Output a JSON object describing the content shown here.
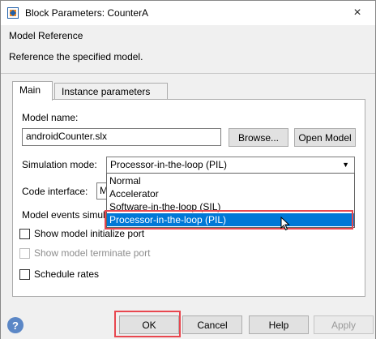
{
  "window": {
    "title": "Block Parameters: CounterA",
    "close_icon": "×"
  },
  "section": {
    "title": "Model Reference",
    "description": "Reference the specified model."
  },
  "tabs": [
    {
      "label": "Main"
    },
    {
      "label": "Instance parameters"
    }
  ],
  "model_name": {
    "label": "Model name:",
    "value": "androidCounter.slx",
    "browse": "Browse...",
    "open": "Open Model"
  },
  "simulation_mode": {
    "label": "Simulation mode:",
    "value": "Processor-in-the-loop (PIL)",
    "options": [
      "Normal",
      "Accelerator",
      "Software-in-the-loop (SIL)",
      "Processor-in-the-loop (PIL)"
    ],
    "highlighted_option": "Processor-in-the-loop (PIL)"
  },
  "code_interface": {
    "label": "Code interface:",
    "value_fragment": "M"
  },
  "model_events": {
    "label_fragment": "Model events simul"
  },
  "checkboxes": [
    {
      "label": "Show model initialize port",
      "checked": false,
      "disabled": false
    },
    {
      "label": "Show model terminate port",
      "checked": false,
      "disabled": true
    },
    {
      "label": "Schedule rates",
      "checked": false,
      "disabled": false
    }
  ],
  "buttons": {
    "ok": "OK",
    "cancel": "Cancel",
    "help": "Help",
    "apply": "Apply"
  },
  "colors": {
    "highlight": "#0078d7",
    "annotation": "#e8474f",
    "help_icon": "#5b87c6"
  }
}
